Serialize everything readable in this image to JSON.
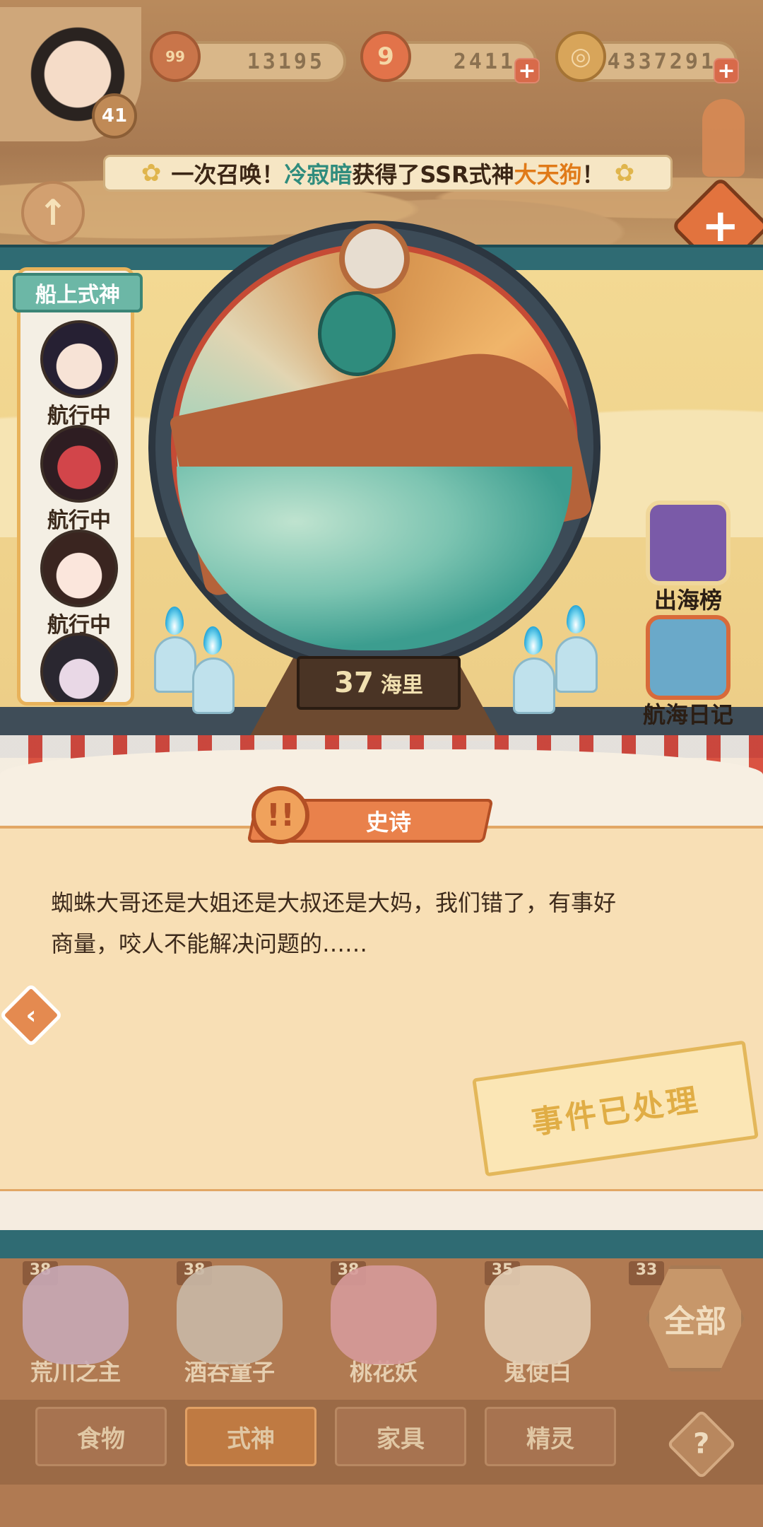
{
  "header": {
    "player_level": "41",
    "resources": [
      {
        "icon": "orb-icon",
        "badge": "99",
        "value": "13195"
      },
      {
        "icon": "magatama-icon",
        "badge": "",
        "value": "2411"
      },
      {
        "icon": "coin-icon",
        "badge": "",
        "value": "4337291"
      }
    ],
    "announcement": {
      "prefix": "一次召唤！",
      "player": "冷寂暗",
      "middle": "获得了SSR式神",
      "shikigami": "大天狗",
      "suffix": "！"
    }
  },
  "voyage": {
    "distance_value": "37",
    "distance_unit": "海里"
  },
  "sidebar": {
    "title": "船上式神",
    "crew": [
      {
        "status": "航行中"
      },
      {
        "status": "航行中"
      },
      {
        "status": "航行中"
      }
    ]
  },
  "right_buttons": [
    {
      "label": "出海榜",
      "icon": "ranking-scroll-icon"
    },
    {
      "label": "航海日记",
      "icon": "journal-book-icon"
    }
  ],
  "event": {
    "rarity_label": "史诗",
    "story_line1": "蜘蛛大哥还是大姐还是大叔还是大妈，我们错了，有事好",
    "story_line2": "商量，咬人不能解决问题的……",
    "stamp": "事件已处理"
  },
  "shikigami_list": [
    {
      "level": "38",
      "name": "荒川之主"
    },
    {
      "level": "38",
      "name": "酒吞童子"
    },
    {
      "level": "38",
      "name": "桃花妖"
    },
    {
      "level": "35",
      "name": "鬼使白"
    },
    {
      "level": "33",
      "name": ""
    }
  ],
  "filter_all": "全部",
  "tabs": [
    {
      "label": "食物",
      "active": false
    },
    {
      "label": "式神",
      "active": true
    },
    {
      "label": "家具",
      "active": false
    },
    {
      "label": "精灵",
      "active": false
    }
  ],
  "colors": {
    "accent_teal": "#2f6b73",
    "epic_orange": "#e9814b",
    "highlight_green": "#2f8c7d",
    "highlight_orange": "#e07a18"
  }
}
